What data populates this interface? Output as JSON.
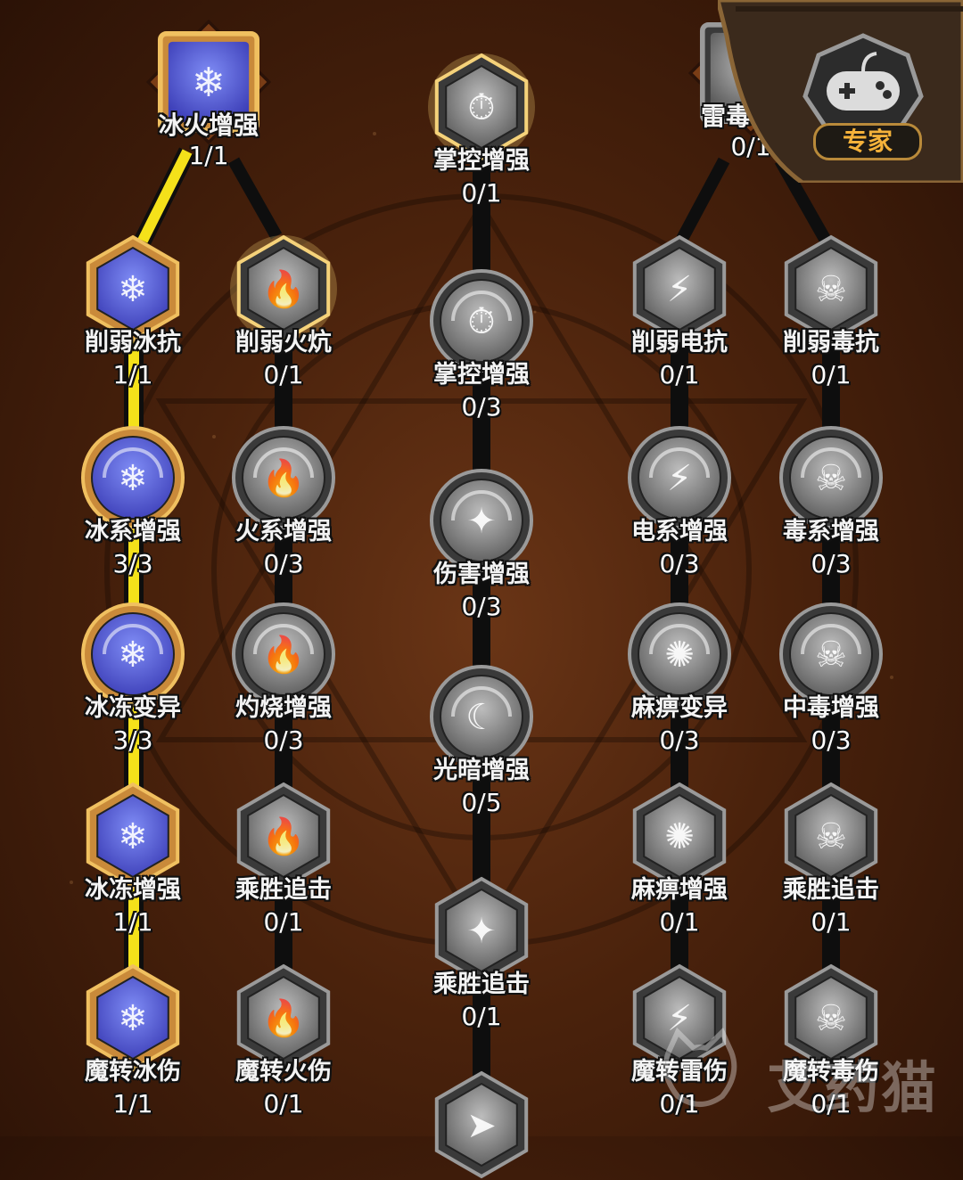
{
  "expert_badge": {
    "label": "专家",
    "icon": "gamepad-icon"
  },
  "watermark": "艾药猫",
  "colors": {
    "active_line": "#f4e11a",
    "inactive_line": "#0e0e0e",
    "gold_frame": "#d5b05a",
    "ice_fill": "#5b6fe8"
  },
  "nodes": [
    {
      "id": "ice-fire-boost",
      "label": "冰火增强",
      "count": "1/1",
      "icon": "snowflake-flame-icon",
      "state": "unlocked",
      "shape": "square",
      "col": 0
    },
    {
      "id": "control-boost-top",
      "label": "掌控增强",
      "count": "0/1",
      "icon": "stopwatch-icon",
      "state": "glow",
      "shape": "hex",
      "col": 2
    },
    {
      "id": "thunder-poison-boost",
      "label": "雷毒增强",
      "count": "0/1",
      "icon": "lightning-skull-icon",
      "state": "locked",
      "shape": "square",
      "col": 3
    },
    {
      "id": "weaken-ice",
      "label": "削弱冰抗",
      "count": "1/1",
      "icon": "snowflake-crossed-icon",
      "state": "unlocked",
      "shape": "hex",
      "col": 0
    },
    {
      "id": "weaken-fire",
      "label": "削弱火炕",
      "count": "0/1",
      "icon": "flame-crossed-icon",
      "state": "glow",
      "shape": "hex",
      "col": 1
    },
    {
      "id": "control-boost",
      "label": "掌控增强",
      "count": "0/3",
      "icon": "stopwatch-icon",
      "state": "locked",
      "shape": "circle",
      "col": 2
    },
    {
      "id": "weaken-electric",
      "label": "削弱电抗",
      "count": "0/1",
      "icon": "lightning-crossed-icon",
      "state": "locked",
      "shape": "hex",
      "col": 3
    },
    {
      "id": "weaken-poison",
      "label": "削弱毒抗",
      "count": "0/1",
      "icon": "skull-crossed-icon",
      "state": "locked",
      "shape": "hex",
      "col": 4
    },
    {
      "id": "ice-boost",
      "label": "冰系增强",
      "count": "3/3",
      "icon": "snowflake-arrows-icon",
      "state": "unlocked",
      "shape": "circle",
      "col": 0
    },
    {
      "id": "fire-boost",
      "label": "火系增强",
      "count": "0/3",
      "icon": "flame-arrows-icon",
      "state": "locked",
      "shape": "circle",
      "col": 1
    },
    {
      "id": "damage-boost",
      "label": "伤害增强",
      "count": "0/3",
      "icon": "spike-arrows-icon",
      "state": "locked",
      "shape": "circle",
      "col": 2
    },
    {
      "id": "electric-boost",
      "label": "电系增强",
      "count": "0/3",
      "icon": "lightning-arrows-icon",
      "state": "locked",
      "shape": "circle",
      "col": 3
    },
    {
      "id": "poison-boost",
      "label": "毒系增强",
      "count": "0/3",
      "icon": "skull-arrows-icon",
      "state": "locked",
      "shape": "circle",
      "col": 4
    },
    {
      "id": "freeze-mutation",
      "label": "冰冻变异",
      "count": "3/3",
      "icon": "snowflake-swirl-icon",
      "state": "unlocked",
      "shape": "circle",
      "col": 0
    },
    {
      "id": "burn-boost",
      "label": "灼烧增强",
      "count": "0/3",
      "icon": "flame-swirl-icon",
      "state": "locked",
      "shape": "circle",
      "col": 1
    },
    {
      "id": "light-dark-boost",
      "label": "光暗增强",
      "count": "0/5",
      "icon": "moon-star-icon",
      "state": "locked",
      "shape": "circle",
      "col": 2
    },
    {
      "id": "paralysis-mutation",
      "label": "麻痹变异",
      "count": "0/3",
      "icon": "vortex-icon",
      "state": "locked",
      "shape": "circle",
      "col": 3
    },
    {
      "id": "poisoning-boost",
      "label": "中毒增强",
      "count": "0/3",
      "icon": "skull-swirl-icon",
      "state": "locked",
      "shape": "circle",
      "col": 4
    },
    {
      "id": "freeze-boost",
      "label": "冰冻增强",
      "count": "1/1",
      "icon": "snowflake-ring-icon",
      "state": "unlocked",
      "shape": "hex",
      "col": 0
    },
    {
      "id": "pursuit-fire",
      "label": "乘胜追击",
      "count": "0/1",
      "icon": "flame-ring-icon",
      "state": "locked",
      "shape": "hex",
      "col": 1
    },
    {
      "id": "pursuit-center",
      "label": "乘胜追击",
      "count": "0/1",
      "icon": "spike-ring-icon",
      "state": "locked",
      "shape": "hex",
      "col": 2
    },
    {
      "id": "paralysis-boost",
      "label": "麻痹增强",
      "count": "0/1",
      "icon": "vortex-ring-icon",
      "state": "locked",
      "shape": "hex",
      "col": 3
    },
    {
      "id": "pursuit-poison",
      "label": "乘胜追击",
      "count": "0/1",
      "icon": "skull-ring-icon",
      "state": "locked",
      "shape": "hex",
      "col": 4
    },
    {
      "id": "magic-ice-damage",
      "label": "魔转冰伤",
      "count": "1/1",
      "icon": "snowflake-target-icon",
      "state": "unlocked",
      "shape": "hex",
      "col": 0
    },
    {
      "id": "magic-fire-damage",
      "label": "魔转火伤",
      "count": "0/1",
      "icon": "flame-target-icon",
      "state": "locked",
      "shape": "hex",
      "col": 1
    },
    {
      "id": "magic-thunder-damage",
      "label": "魔转雷伤",
      "count": "0/1",
      "icon": "lightning-target-icon",
      "state": "locked",
      "shape": "hex",
      "col": 3
    },
    {
      "id": "magic-poison-damage",
      "label": "魔转毒伤",
      "count": "0/1",
      "icon": "skull-target-icon",
      "state": "locked",
      "shape": "hex",
      "col": 4
    },
    {
      "id": "hidden-bottom",
      "label": "",
      "count": "",
      "icon": "runner-icon",
      "state": "locked",
      "shape": "hex",
      "col": 2
    }
  ]
}
